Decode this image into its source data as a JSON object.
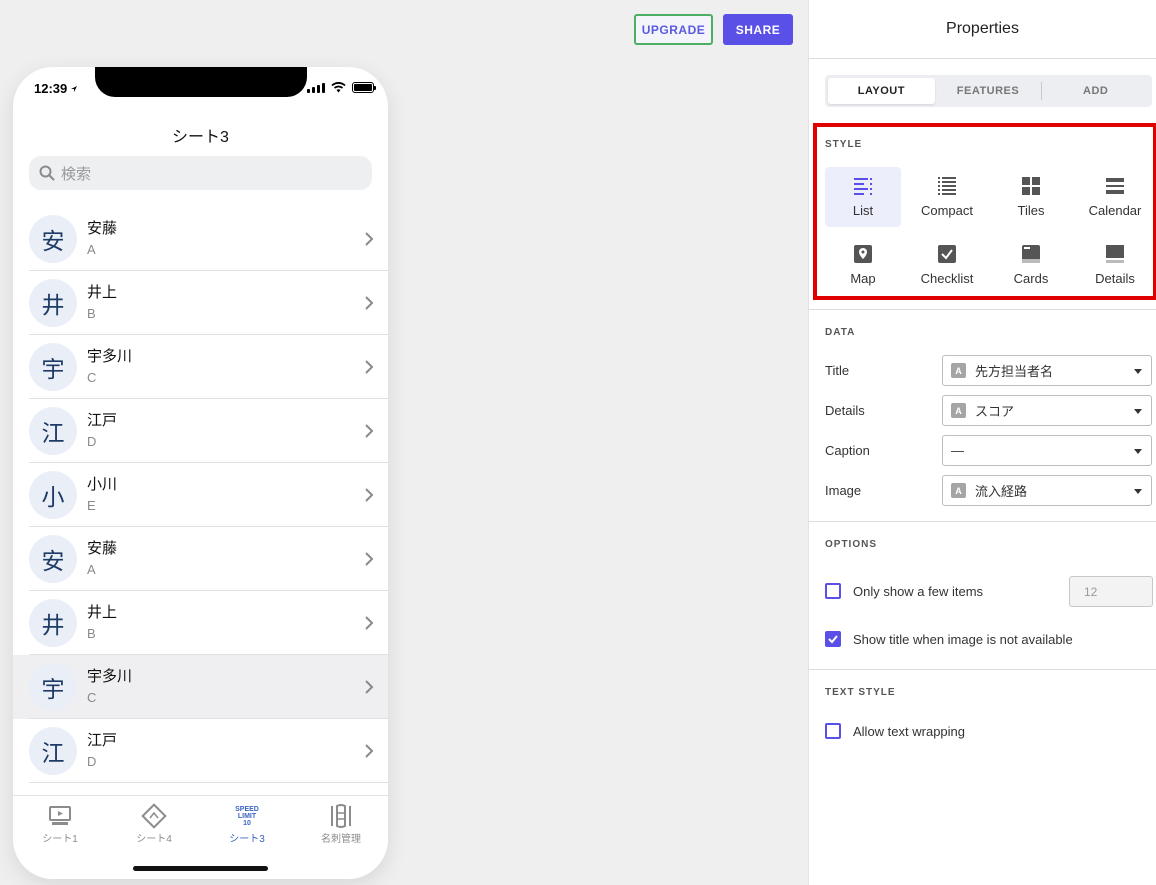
{
  "header": {
    "upgrade_label": "UPGRADE",
    "share_label": "SHARE"
  },
  "phone": {
    "status": {
      "time": "12:39"
    },
    "title": "シート3",
    "search_placeholder": "検索",
    "rows": [
      {
        "avatar": "安",
        "title": "安藤",
        "subtitle": "A"
      },
      {
        "avatar": "井",
        "title": "井上",
        "subtitle": "B"
      },
      {
        "avatar": "宇",
        "title": "宇多川",
        "subtitle": "C"
      },
      {
        "avatar": "江",
        "title": "江戸",
        "subtitle": "D"
      },
      {
        "avatar": "小",
        "title": "小川",
        "subtitle": "E"
      },
      {
        "avatar": "安",
        "title": "安藤",
        "subtitle": "A"
      },
      {
        "avatar": "井",
        "title": "井上",
        "subtitle": "B"
      },
      {
        "avatar": "宇",
        "title": "宇多川",
        "subtitle": "C",
        "selected": true
      },
      {
        "avatar": "江",
        "title": "江戸",
        "subtitle": "D"
      }
    ],
    "tabs": [
      {
        "label": "シート1",
        "icon": "monitor-icon"
      },
      {
        "label": "シート4",
        "icon": "diamond-sign-icon"
      },
      {
        "label": "シート3",
        "icon": "speed-limit-sign-icon",
        "sign_text": "SPEED LIMIT 10",
        "active": true
      },
      {
        "label": "名刺管理",
        "icon": "boat-paddle-icon"
      }
    ]
  },
  "panel": {
    "title": "Properties",
    "segments": [
      "LAYOUT",
      "FEATURES",
      "ADD"
    ],
    "active_segment": "LAYOUT",
    "style_label": "STYLE",
    "styles": [
      {
        "label": "List",
        "icon": "list-icon",
        "active": true
      },
      {
        "label": "Compact",
        "icon": "compact-list-icon"
      },
      {
        "label": "Tiles",
        "icon": "tiles-icon"
      },
      {
        "label": "Calendar",
        "icon": "calendar-icon"
      },
      {
        "label": "Map",
        "icon": "map-pin-icon"
      },
      {
        "label": "Checklist",
        "icon": "checklist-icon"
      },
      {
        "label": "Cards",
        "icon": "cards-icon"
      },
      {
        "label": "Details",
        "icon": "details-icon"
      }
    ],
    "data_label": "DATA",
    "fields": [
      {
        "label": "Title",
        "value": "先方担当者名",
        "chip": "A"
      },
      {
        "label": "Details",
        "value": "スコア",
        "chip": "A"
      },
      {
        "label": "Caption",
        "value": "—",
        "chip": ""
      },
      {
        "label": "Image",
        "value": "流入経路",
        "chip": "A"
      }
    ],
    "options_label": "OPTIONS",
    "option_few_items": {
      "label": "Only show a few items",
      "checked": false,
      "value": "12"
    },
    "option_show_title": {
      "label": "Show title when image is not available",
      "checked": true
    },
    "text_style_label": "TEXT STYLE",
    "option_wrap": {
      "label": "Allow text wrapping",
      "checked": false
    }
  },
  "colors": {
    "accent": "#5a50e8",
    "highlight": "#e00000",
    "upgrade_border": "#4caf63"
  }
}
